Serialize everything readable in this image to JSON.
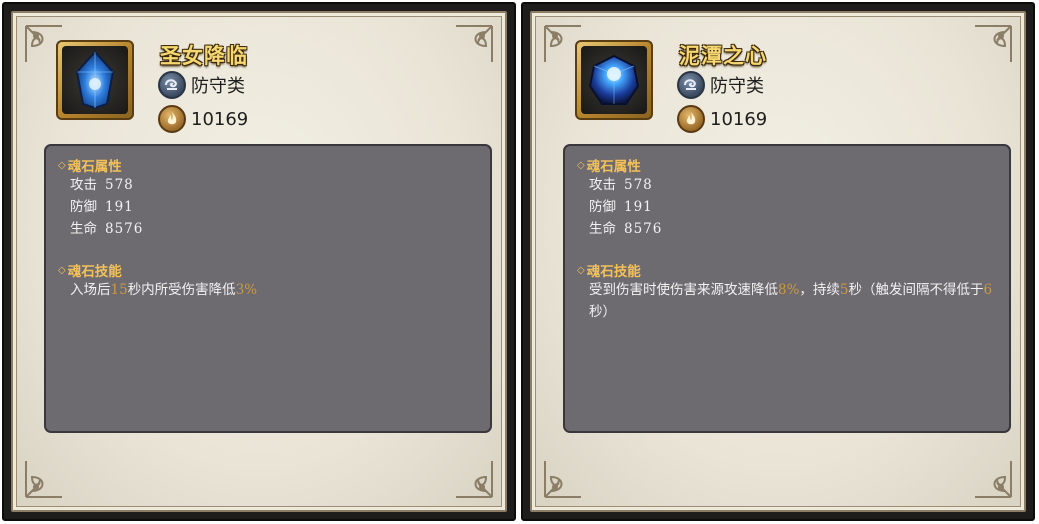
{
  "cards": [
    {
      "title": "圣女降临",
      "category": "防守类",
      "power": "10169",
      "gem_color": "#2f7fe0",
      "attributes_header": "魂石属性",
      "stats": [
        {
          "label": "攻击",
          "value": "578"
        },
        {
          "label": "防御",
          "value": "191"
        },
        {
          "label": "生命",
          "value": "8576"
        }
      ],
      "skill_header": "魂石技能",
      "skill_parts": [
        "入场后",
        "15",
        "秒内所受伤害降低",
        "3%",
        "",
        "",
        ""
      ]
    },
    {
      "title": "泥潭之心",
      "category": "防守类",
      "power": "10169",
      "gem_color": "#2a6cd8",
      "attributes_header": "魂石属性",
      "stats": [
        {
          "label": "攻击",
          "value": "578"
        },
        {
          "label": "防御",
          "value": "191"
        },
        {
          "label": "生命",
          "value": "8576"
        }
      ],
      "skill_header": "魂石技能",
      "skill_parts": [
        "受到伤害时使伤害来源攻速降低",
        "8%",
        "，持续",
        "5",
        "秒（触发间隔不得低于",
        "6",
        "秒）"
      ]
    }
  ],
  "icons": {
    "category_icon": "shield-swirl-icon",
    "power_icon": "flame-power-icon",
    "section_icon": "diamond-bullet-icon"
  },
  "colors": {
    "title_gold": "#f6d873",
    "section_gold": "#f2c15a",
    "highlight_value": "#c99a45",
    "panel_bg": "#6d6a70",
    "frame_bg": "#e9e4d6"
  }
}
